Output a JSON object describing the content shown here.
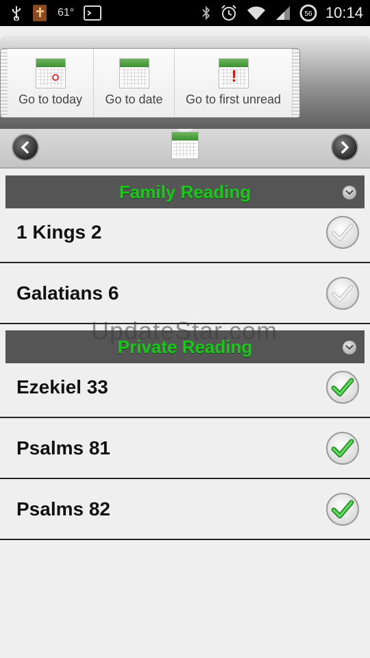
{
  "status_bar": {
    "temperature": "61°",
    "time": "10:14",
    "battery_level": "56",
    "icons": [
      "usb-icon",
      "bible-app-icon",
      "terminal-icon",
      "bluetooth-icon",
      "alarm-icon",
      "wifi-icon",
      "signal-icon",
      "battery-icon"
    ]
  },
  "toolbar": {
    "buttons": [
      {
        "label": "Go to today",
        "icon": "calendar-today-icon"
      },
      {
        "label": "Go to date",
        "icon": "calendar-icon"
      },
      {
        "label": "Go to first unread",
        "icon": "calendar-unread-icon"
      }
    ]
  },
  "nav": {
    "prev_icon": "chevron-left-icon",
    "next_icon": "chevron-right-icon",
    "calendar_icon": "calendar-icon"
  },
  "sections": [
    {
      "title": "Family Reading",
      "items": [
        {
          "label": "1 Kings 2",
          "read": false
        },
        {
          "label": "Galatians 6",
          "read": false
        }
      ]
    },
    {
      "title": "Private Reading",
      "items": [
        {
          "label": "Ezekiel 33",
          "read": true
        },
        {
          "label": "Psalms 81",
          "read": true
        },
        {
          "label": "Psalms 82",
          "read": true
        }
      ]
    }
  ],
  "watermark": "UpdateStar.com",
  "colors": {
    "section_title": "#1fc41f",
    "check_read": "#3cc43c",
    "check_unread": "#d0d0d0",
    "section_header_bg": "#555555"
  }
}
